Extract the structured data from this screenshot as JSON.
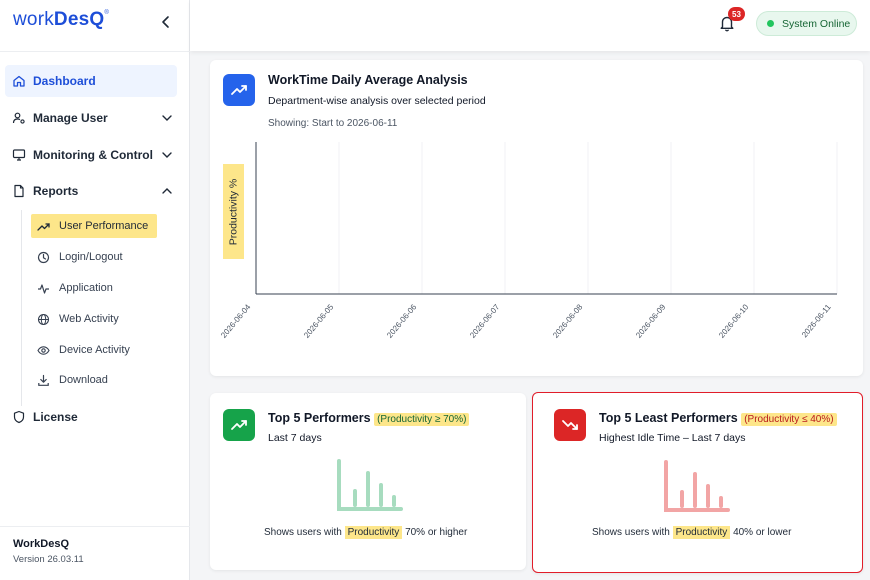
{
  "app": {
    "logo_light": "work",
    "logo_bold": "DesQ",
    "logo_mark": "®"
  },
  "sidebar": {
    "items": [
      {
        "label": "Dashboard",
        "icon": "home-icon"
      },
      {
        "label": "Manage User",
        "icon": "user-settings-icon"
      },
      {
        "label": "Monitoring & Control",
        "icon": "monitor-icon"
      },
      {
        "label": "Reports",
        "icon": "file-icon"
      },
      {
        "label": "License",
        "icon": "shield-icon"
      }
    ],
    "report_sub_items": [
      {
        "label": "User Performance",
        "icon": "trending-up-icon"
      },
      {
        "label": "Login/Logout",
        "icon": "clock-icon"
      },
      {
        "label": "Application",
        "icon": "activity-icon"
      },
      {
        "label": "Web Activity",
        "icon": "globe-icon"
      },
      {
        "label": "Device Activity",
        "icon": "eye-icon"
      },
      {
        "label": "Download",
        "icon": "download-icon"
      }
    ],
    "footer": {
      "brand": "WorkDesQ",
      "version": "Version 26.03.11"
    }
  },
  "header": {
    "notification_count": "53",
    "status": "System Online"
  },
  "colors": {
    "accent": "#1d4ed8",
    "highlight": "#fde68a",
    "success": "#16a34a",
    "danger": "#dc2626"
  },
  "analysis": {
    "title": "WorkTime Daily Average Analysis",
    "subtitle": "Department-wise analysis over selected period",
    "showing": "Showing: Start to 2026-06-11"
  },
  "chart_data": {
    "type": "bar",
    "ylabel": "Productivity %",
    "xlabel": "",
    "categories": [
      "2026-06-04",
      "2026-06-05",
      "2026-06-06",
      "2026-06-07",
      "2026-06-08",
      "2026-06-09",
      "2026-06-10",
      "2026-06-11"
    ],
    "series": [],
    "grid": true
  },
  "top_performers": {
    "title": "Top 5 Performers",
    "badge": "(Productivity ≥ 70%)",
    "subtitle": "Last 7 days",
    "desc_before": "Shows users with",
    "desc_highlight": "Productivity",
    "desc_after": "70% or higher"
  },
  "least_performers": {
    "title": "Top 5 Least Performers",
    "badge": "(Productivity ≤ 40%)",
    "subtitle": "Highest Idle Time – Last 7 days",
    "desc_before": "Shows users with",
    "desc_highlight": "Productivity",
    "desc_after": "40% or lower"
  }
}
